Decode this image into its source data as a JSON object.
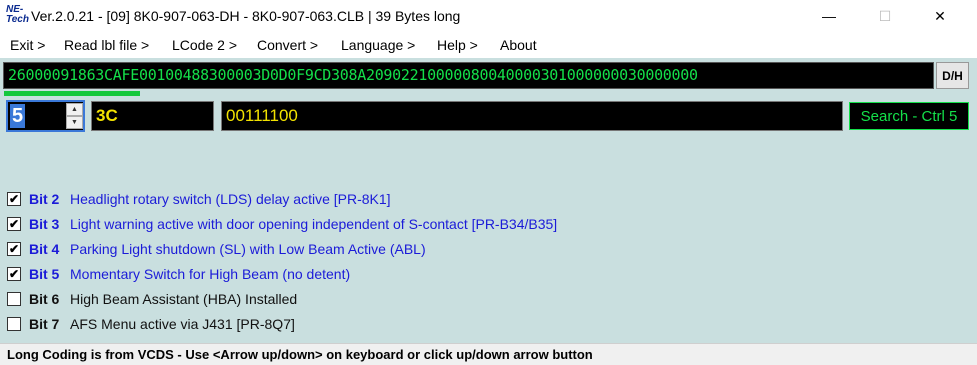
{
  "window": {
    "logo": {
      "line1": "NE-",
      "line2": "Tech"
    },
    "title": "Ver.2.0.21 - [09] 8K0-907-063-DH - 8K0-907-063.CLB | 39 Bytes long",
    "minimize_glyph": "—",
    "maximize_glyph": "☐",
    "close_glyph": "✕"
  },
  "menu": {
    "exit": "Exit >",
    "read_lbl": "Read lbl file >",
    "lcode": "LCode 2 >",
    "convert": "Convert >",
    "language": "Language >",
    "help": "Help >",
    "about": "About"
  },
  "coding": {
    "value": "26000091863CAFE00100488300003D0D0F9CD308A209022100000800400003010000003000000 0",
    "dh_label": "D/H",
    "progress_fraction": 0.14
  },
  "byte": {
    "value": "5",
    "hex": "3C",
    "binary": "00111100",
    "spin_up": "▲",
    "spin_down": "▼"
  },
  "search_label": "Search - Ctrl 5",
  "bits": [
    {
      "label": "Bit 2",
      "desc": "Headlight rotary switch (LDS) delay active  [PR-8K1]",
      "checked": true,
      "mark": "✔"
    },
    {
      "label": "Bit 3",
      "desc": "Light warning active with door opening independent of S-contact [PR-B34/B35]",
      "checked": true,
      "mark": "✔"
    },
    {
      "label": "Bit 4",
      "desc": "Parking Light shutdown (SL) with Low Beam Active (ABL)",
      "checked": true,
      "mark": "✔"
    },
    {
      "label": "Bit 5",
      "desc": "Momentary Switch for High Beam (no detent)",
      "checked": true,
      "mark": "✔"
    },
    {
      "label": "Bit 6",
      "desc": "High Beam Assistant (HBA) Installed",
      "checked": false,
      "mark": ""
    },
    {
      "label": "Bit 7",
      "desc": "AFS Menu active via J431 [PR-8Q7]",
      "checked": false,
      "mark": ""
    }
  ],
  "status": "Long Coding is from VCDS - Use <Arrow up/down> on keyboard or click up/down arrow button",
  "colors": {
    "panel_bg": "#c9dfdf",
    "green_text": "#14e04a",
    "yellow_text": "#f2e200",
    "active_bit": "#1b1bd8"
  }
}
